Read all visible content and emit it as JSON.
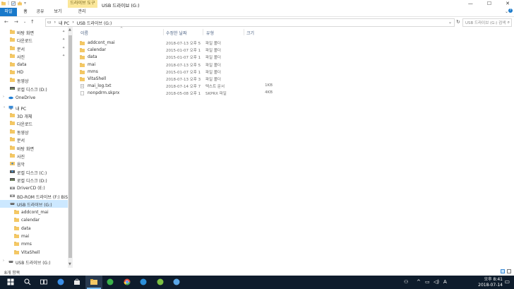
{
  "window": {
    "title": "USB 드라이브 (G:)",
    "context_tab": "드라이브 도구",
    "controls": {
      "minimize": "—",
      "maximize": "☐",
      "close": "✕"
    }
  },
  "ribbon": {
    "tabs": [
      {
        "label": "파일",
        "active": true
      },
      {
        "label": "홈"
      },
      {
        "label": "공유"
      },
      {
        "label": "보기"
      },
      {
        "label": "관리"
      }
    ]
  },
  "address": {
    "crumbs": [
      "내 PC",
      "USB 드라이브 (G:)"
    ],
    "search_placeholder": "USB 드라이브 (G:) 검색"
  },
  "sidebar": {
    "quick_access": [
      {
        "label": "바탕 화면",
        "icon": "desktop-folder-icon",
        "pinned": true
      },
      {
        "label": "다운로드",
        "icon": "download-folder-icon",
        "pinned": true
      },
      {
        "label": "문서",
        "icon": "documents-folder-icon",
        "pinned": true
      },
      {
        "label": "사진",
        "icon": "pictures-folder-icon",
        "pinned": true
      },
      {
        "label": "data",
        "icon": "folder-icon"
      },
      {
        "label": "HD",
        "icon": "folder-icon"
      },
      {
        "label": "동영상",
        "icon": "videos-folder-icon"
      },
      {
        "label": "로컬 디스크 (D:)",
        "icon": "drive-icon"
      }
    ],
    "onedrive": "OneDrive",
    "this_pc": "내 PC",
    "pc_items": [
      {
        "label": "3D 개체",
        "icon": "3d-objects-folder-icon"
      },
      {
        "label": "다운로드",
        "icon": "download-folder-icon"
      },
      {
        "label": "동영상",
        "icon": "videos-folder-icon"
      },
      {
        "label": "문서",
        "icon": "documents-folder-icon"
      },
      {
        "label": "바탕 화면",
        "icon": "desktop-folder-icon"
      },
      {
        "label": "사진",
        "icon": "pictures-folder-icon"
      },
      {
        "label": "음악",
        "icon": "music-folder-icon"
      },
      {
        "label": "로컬 디스크 (C:)",
        "icon": "windows-drive-icon"
      },
      {
        "label": "로컬 디스크 (D:)",
        "icon": "drive-icon"
      },
      {
        "label": "DriverCD (E:)",
        "icon": "cd-drive-icon"
      },
      {
        "label": "BD-ROM 드라이브 (F:) BiSH",
        "icon": "bd-rom-icon"
      },
      {
        "label": "USB 드라이브 (G:)",
        "icon": "usb-drive-icon",
        "selected": true
      }
    ],
    "usb_children": [
      "addcont_mai",
      "calendar",
      "data",
      "mai",
      "mms",
      "VitaShell"
    ],
    "bottom": "USB 드라이브 (G:)"
  },
  "columns": {
    "name": "이름",
    "modified": "수정한 날짜",
    "type": "유형",
    "size": "크기"
  },
  "files": [
    {
      "name": "addcont_mai",
      "modified": "2018-07-13 오후 5",
      "type": "파일 폴더",
      "size": "",
      "kind": "folder"
    },
    {
      "name": "calendar",
      "modified": "2015-01-07 오후 1",
      "type": "파일 폴더",
      "size": "",
      "kind": "folder"
    },
    {
      "name": "data",
      "modified": "2015-01-07 오후 1",
      "type": "파일 폴더",
      "size": "",
      "kind": "folder"
    },
    {
      "name": "mai",
      "modified": "2018-07-13 오후 5",
      "type": "파일 폴더",
      "size": "",
      "kind": "folder"
    },
    {
      "name": "mms",
      "modified": "2015-01-07 오후 1",
      "type": "파일 폴더",
      "size": "",
      "kind": "folder"
    },
    {
      "name": "VitaShell",
      "modified": "2018-07-13 오후 3",
      "type": "파일 폴더",
      "size": "",
      "kind": "folder"
    },
    {
      "name": "mai_log.txt",
      "modified": "2018-07-14 오후 7",
      "type": "텍스트 문서",
      "size": "1KB",
      "kind": "text"
    },
    {
      "name": "nonpdrm.skprx",
      "modified": "2018-05-08 오후 1",
      "type": "SKPRX 파일",
      "size": "4KB",
      "kind": "file"
    }
  ],
  "status": {
    "items": "8개 항목"
  },
  "taskbar": {
    "apps": [
      {
        "icon": "windows-start-icon",
        "color": "#ffffff"
      },
      {
        "icon": "search-icon",
        "color": "#ffffff"
      },
      {
        "icon": "task-view-icon",
        "color": "#ffffff"
      },
      {
        "icon": "edge-icon",
        "color": "#3a8ee6"
      },
      {
        "icon": "store-icon",
        "color": "#e8e8e8"
      },
      {
        "icon": "file-explorer-icon",
        "color": "#f4c865",
        "active": true
      },
      {
        "icon": "green-app-icon",
        "color": "#3bb34a"
      },
      {
        "icon": "chrome-icon",
        "color": "#e24a3b"
      },
      {
        "icon": "internet-explorer-icon",
        "color": "#2b8fd9"
      },
      {
        "icon": "android-app-icon",
        "color": "#7cc142"
      },
      {
        "icon": "link-app-icon",
        "color": "#5aa6e6"
      }
    ],
    "time": "오후 8:41",
    "date": "2018-07-14",
    "ime": "A"
  }
}
